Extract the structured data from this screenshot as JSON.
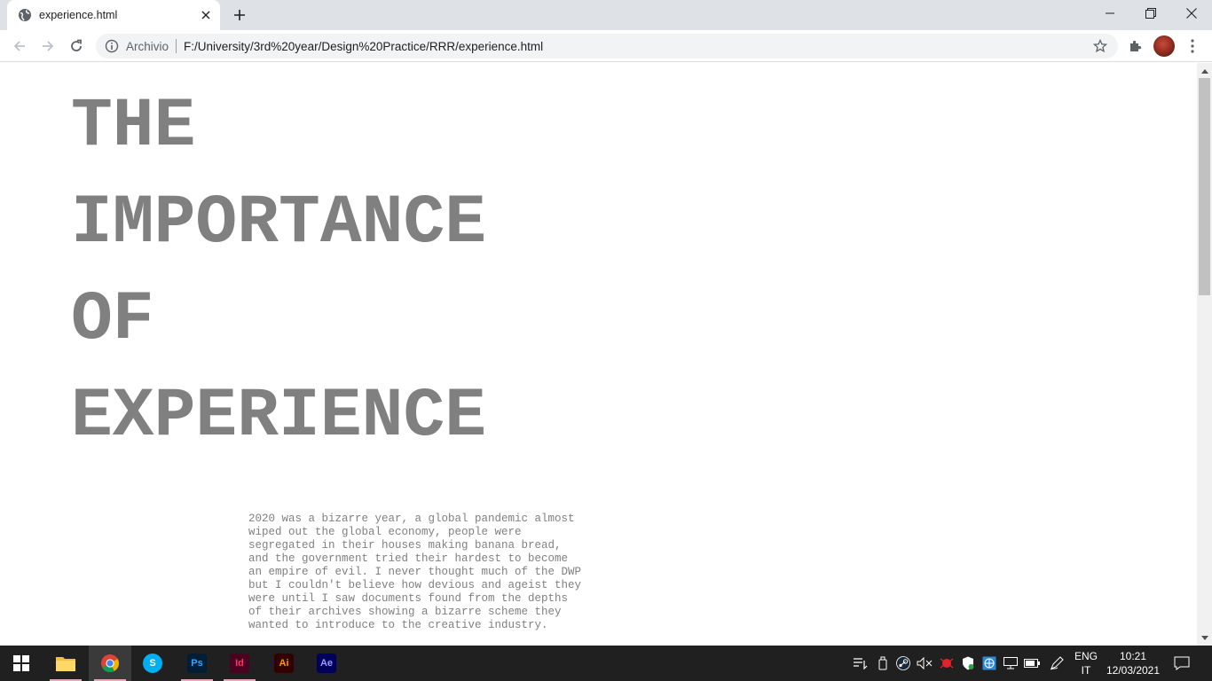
{
  "browser": {
    "tab_title": "experience.html",
    "scheme_label": "Archivio",
    "url": "F:/University/3rd%20year/Design%20Practice/RRR/experience.html"
  },
  "page": {
    "headline_lines": [
      "THE",
      "IMPORTANCE",
      "OF",
      "EXPERIENCE"
    ],
    "body": "2020 was a bizarre year, a global pandemic almost wiped out the global economy, people were segregated in their houses making banana bread, and the government tried their hardest to become an empire of evil. I never thought much of the DWP but I couldn't believe how devious and ageist they were until I saw documents found from the depths of their archives showing a bizarre scheme they wanted to introduce to the creative industry."
  },
  "taskbar": {
    "apps": [
      {
        "name": "file-explorer",
        "label": ""
      },
      {
        "name": "chrome",
        "label": ""
      },
      {
        "name": "skype",
        "label": "S"
      },
      {
        "name": "photoshop",
        "label": "Ps"
      },
      {
        "name": "indesign",
        "label": "Id"
      },
      {
        "name": "illustrator",
        "label": "Ai"
      },
      {
        "name": "after-effects",
        "label": "Ae"
      }
    ],
    "language_line1": "ENG",
    "language_line2": "IT",
    "time": "10:21",
    "date": "12/03/2021"
  },
  "colors": {
    "text_gray": "#808080",
    "taskbar": "#202020",
    "photoshop": "#31a8ff",
    "indesign": "#ff3366",
    "illustrator": "#ff9a00",
    "after_effects": "#9999ff"
  }
}
